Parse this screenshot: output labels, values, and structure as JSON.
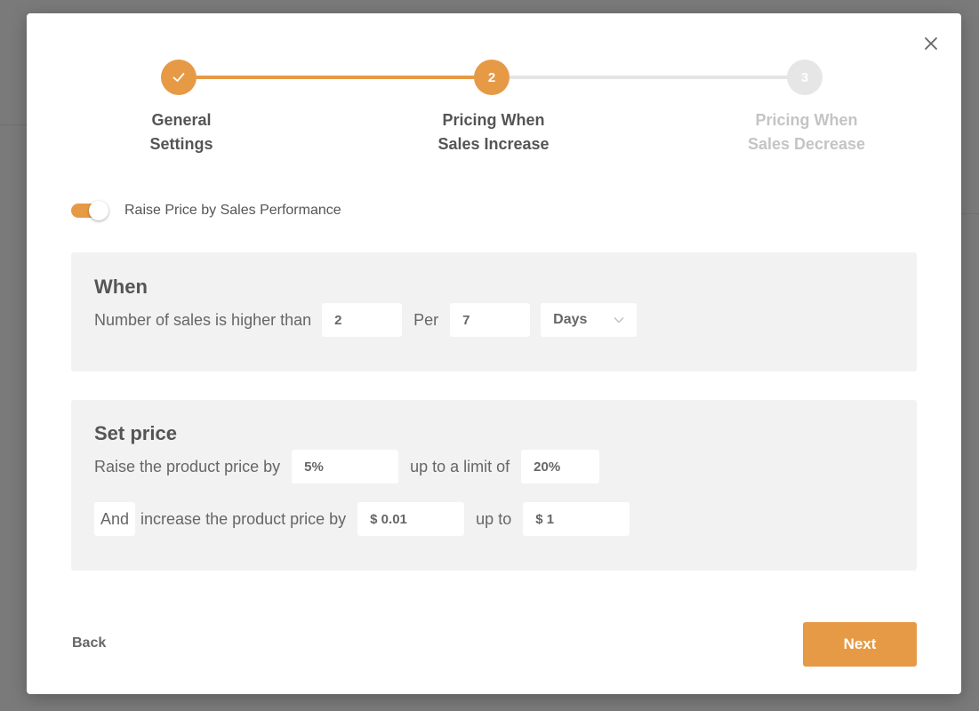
{
  "colors": {
    "accent": "#e69a46",
    "panel_bg": "#f2f2f2",
    "text": "#555555",
    "muted": "#c4c4c4"
  },
  "stepper": {
    "steps": [
      {
        "number": "1",
        "label_line1": "General",
        "label_line2": "Settings",
        "state": "completed",
        "icon": "check-icon"
      },
      {
        "number": "2",
        "label_line1": "Pricing When",
        "label_line2": "Sales Increase",
        "state": "active"
      },
      {
        "number": "3",
        "label_line1": "Pricing When",
        "label_line2": "Sales Decrease",
        "state": "upcoming"
      }
    ]
  },
  "toggle": {
    "label": "Raise Price by Sales Performance",
    "on": true
  },
  "when": {
    "title": "When",
    "text_before": "Number of sales is higher than",
    "sales_count": "2",
    "text_per": "Per",
    "period_value": "7",
    "period_unit": "Days"
  },
  "set_price": {
    "title": "Set price",
    "row1": {
      "text_before": "Raise the product price by",
      "percent": "5%",
      "text_limit": "up to a limit of",
      "limit": "20%"
    },
    "row2": {
      "and_label": "And",
      "text_before": "increase the product price by",
      "amount": "$ 0.01",
      "text_upto": "up to",
      "max_amount": "$ 1"
    }
  },
  "footer": {
    "back_label": "Back",
    "next_label": "Next"
  }
}
